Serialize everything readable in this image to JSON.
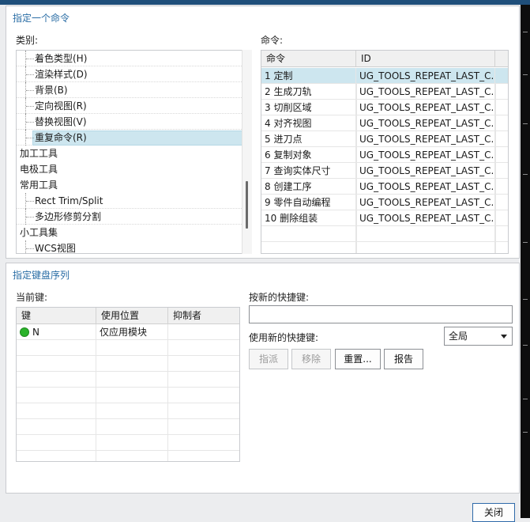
{
  "colors": {
    "title_blue": "#2a6da5",
    "selection": "#cde6ef",
    "top_bar": "#1f4f7a",
    "status_green": "#2bb32b"
  },
  "command_section": {
    "title": "指定一个命令",
    "category_label": "类别:",
    "command_label": "命令:",
    "tree": [
      {
        "label": "着色类型(H)",
        "child": true
      },
      {
        "label": "渲染样式(D)",
        "child": true
      },
      {
        "label": "背景(B)",
        "child": true
      },
      {
        "label": "定向视图(R)",
        "child": true
      },
      {
        "label": "替换视图(V)",
        "child": true
      },
      {
        "label": "重复命令(R)",
        "child": true,
        "selected": true
      },
      {
        "label": "加工工具",
        "child": false
      },
      {
        "label": "电极工具",
        "child": false
      },
      {
        "label": "常用工具",
        "child": false
      },
      {
        "label": "Rect Trim/Split",
        "child": true
      },
      {
        "label": "多边形修剪分割",
        "child": true
      },
      {
        "label": "小工具集",
        "child": false
      },
      {
        "label": "WCS视图",
        "child": true
      }
    ],
    "commands_table": {
      "headers": [
        "命令",
        "ID"
      ],
      "rows": [
        [
          "1 定制",
          "UG_TOOLS_REPEAT_LAST_C..."
        ],
        [
          "2 生成刀轨",
          "UG_TOOLS_REPEAT_LAST_C..."
        ],
        [
          "3 切削区域",
          "UG_TOOLS_REPEAT_LAST_C..."
        ],
        [
          "4 对齐视图",
          "UG_TOOLS_REPEAT_LAST_C..."
        ],
        [
          "5 进刀点",
          "UG_TOOLS_REPEAT_LAST_C..."
        ],
        [
          "6 复制对象",
          "UG_TOOLS_REPEAT_LAST_C..."
        ],
        [
          "7 查询实体尺寸",
          "UG_TOOLS_REPEAT_LAST_C..."
        ],
        [
          "8 创建工序",
          "UG_TOOLS_REPEAT_LAST_C..."
        ],
        [
          "9 零件自动编程",
          "UG_TOOLS_REPEAT_LAST_C..."
        ],
        [
          "10 删除组装",
          "UG_TOOLS_REPEAT_LAST_C..."
        ]
      ],
      "selected_row": 0
    }
  },
  "key_section": {
    "title": "指定键盘序列",
    "current_label": "当前键:",
    "table": {
      "headers": [
        "键",
        "使用位置",
        "抑制者"
      ],
      "rows": [
        [
          "N",
          "仅应用模块",
          ""
        ]
      ]
    },
    "new_key_label": "按新的快捷键:",
    "new_key_value": "",
    "use_label": "使用新的快捷键:",
    "scope": "全局",
    "buttons": {
      "assign": "指派",
      "remove": "移除",
      "reset": "重置...",
      "report": "报告"
    }
  },
  "close_button": "关闭"
}
